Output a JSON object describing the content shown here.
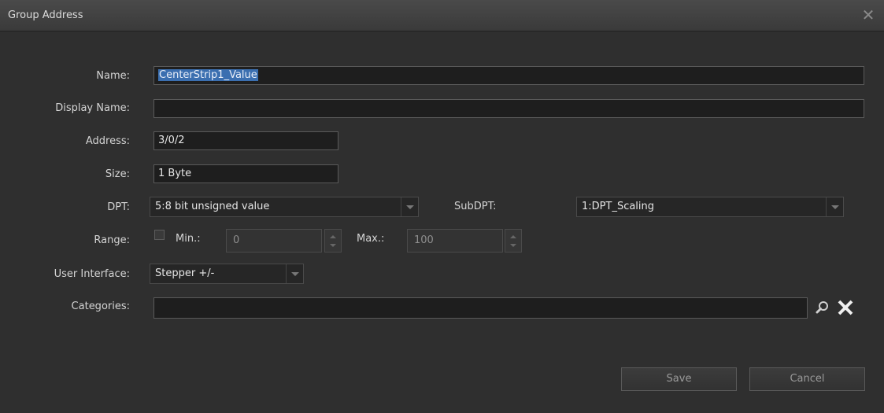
{
  "window": {
    "title": "Group Address",
    "close_icon": "close-icon"
  },
  "form": {
    "name": {
      "label": "Name:",
      "value": "CenterStrip1_Value"
    },
    "display_name": {
      "label": "Display Name:",
      "value": ""
    },
    "address": {
      "label": "Address:",
      "value": "3/0/2"
    },
    "size": {
      "label": "Size:",
      "value": "1 Byte"
    },
    "dpt": {
      "label": "DPT:",
      "value": "5:8 bit unsigned value"
    },
    "subdpt": {
      "label": "SubDPT:",
      "value": "1:DPT_Scaling"
    },
    "range": {
      "label": "Range:",
      "checked": false,
      "min_label": "Min.:",
      "min_value": "0",
      "max_label": "Max.:",
      "max_value": "100"
    },
    "user_interface": {
      "label": "User Interface:",
      "value": "Stepper +/-"
    },
    "categories": {
      "label": "Categories:",
      "value": ""
    }
  },
  "buttons": {
    "save": "Save",
    "cancel": "Cancel"
  },
  "colors": {
    "background": "#2f2f2f",
    "field_bg": "#1e1e1e",
    "selection": "#3b6fb0"
  }
}
